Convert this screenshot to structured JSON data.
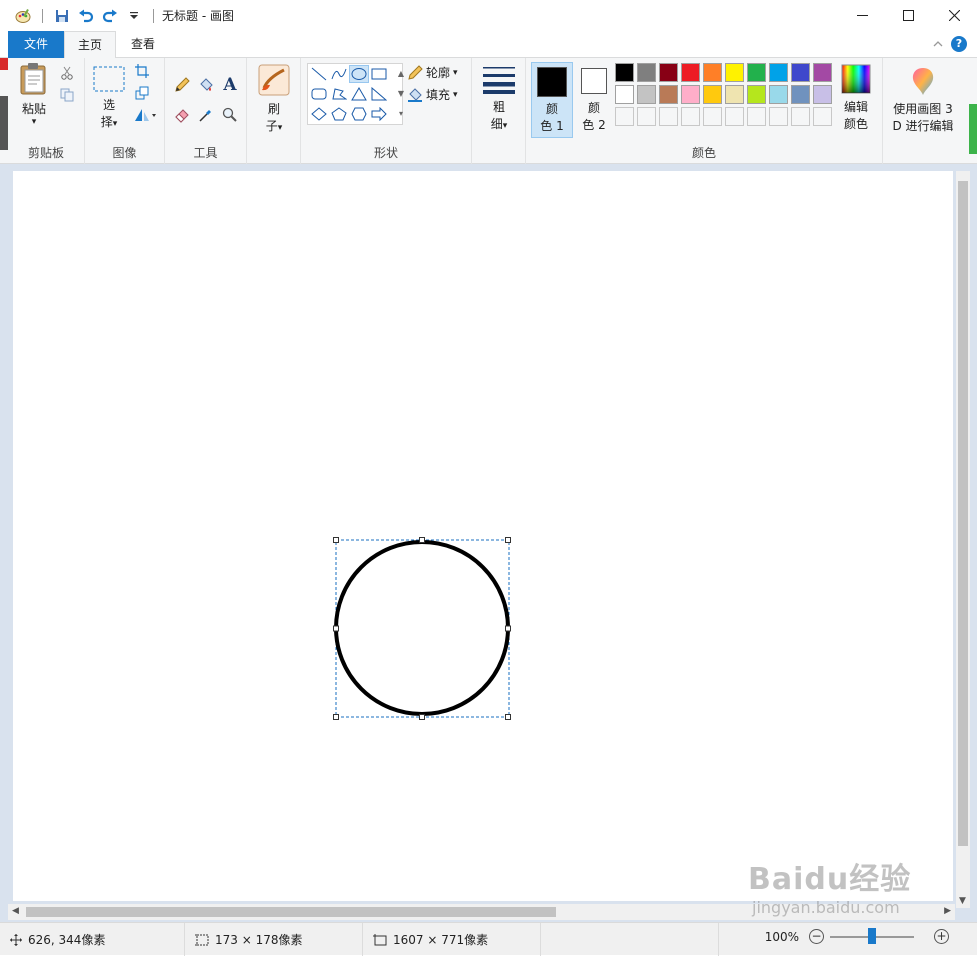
{
  "window": {
    "title": "无标题 - 画图",
    "minimize_icon": "minimize-icon",
    "maximize_icon": "maximize-icon",
    "close_icon": "close-icon"
  },
  "quick_access": [
    "paint-app-icon",
    "save-icon",
    "undo-icon",
    "redo-icon",
    "customize-dropdown-icon"
  ],
  "tabs": {
    "file": "文件",
    "home": "主页",
    "view": "查看"
  },
  "ribbon": {
    "clipboard": {
      "label": "剪贴板",
      "paste": "粘贴",
      "paste_arrow": "▾"
    },
    "image": {
      "label": "图像",
      "select": "选",
      "select2": "择",
      "select_arrow": "▾"
    },
    "tools": {
      "label": "工具"
    },
    "brush": {
      "label": "刷",
      "label2": "子",
      "arrow": "▾"
    },
    "shapes": {
      "label": "形状",
      "outline": "轮廓",
      "fill": "填充"
    },
    "size": {
      "label": "粗",
      "label2": "细",
      "arrow": "▾"
    },
    "colors": {
      "label": "颜色",
      "color1": "颜",
      "color1b": "色 1",
      "color2": "颜",
      "color2b": "色 2",
      "edit": "编辑",
      "edit2": "颜色",
      "color1_value": "#000000",
      "color2_value": "#ffffff",
      "palette_row1": [
        "#000000",
        "#7f7f7f",
        "#880015",
        "#ed1c24",
        "#ff7f27",
        "#fff200",
        "#22b14c",
        "#00a2e8",
        "#3f48cc",
        "#a349a4"
      ],
      "palette_row2": [
        "#ffffff",
        "#c3c3c3",
        "#b97a57",
        "#ffaec9",
        "#ffc90e",
        "#efe4b0",
        "#b5e61d",
        "#99d9ea",
        "#7092be",
        "#c8bfe7"
      ]
    },
    "paint3d": {
      "line1": "使用画图 3",
      "line2": "D 进行编辑"
    }
  },
  "status": {
    "cursor": "626, 344像素",
    "selection": "173 × 178像素",
    "canvas_size": "1607 × 771像素",
    "zoom": "100%"
  },
  "watermark": {
    "text": "Baidu经验",
    "url": "jingyan.baidu.com"
  }
}
